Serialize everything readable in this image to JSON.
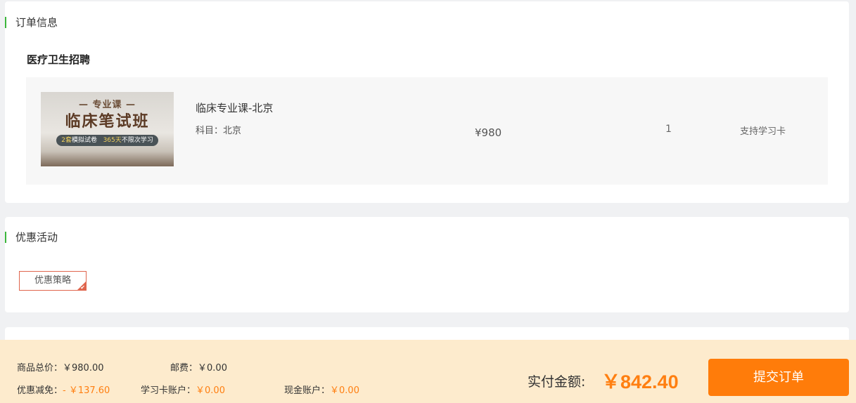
{
  "order_section": {
    "title": "订单信息",
    "category": "医疗卫生招聘",
    "item": {
      "thumbnail": {
        "subtitle": "— 专业课 —",
        "main": "临床笔试班",
        "pill_a_num": "2套",
        "pill_a_text": "模拟试卷",
        "pill_b_num": "365天",
        "pill_b_text": "不限次学习"
      },
      "name": "临床专业课-北京",
      "subject": "科目：北京",
      "price": "¥980",
      "quantity": "1",
      "support": "支持学习卡"
    }
  },
  "promo_section": {
    "title": "优惠活动",
    "tag_label": "优惠策略",
    "check_icon": "check-icon"
  },
  "footer": {
    "goods_total_label": "商品总价：",
    "goods_total_value": "￥980.00",
    "shipping_label": "邮费：",
    "shipping_value": "￥0.00",
    "discount_label": "优惠减免：",
    "discount_value": "- ￥137.60",
    "card_account_label": "学习卡账户：",
    "card_account_value": "￥0.00",
    "cash_account_label": "现金账户：",
    "cash_account_value": "￥0.00",
    "total_label": "实付金额:",
    "total_value": "￥842.40",
    "submit_label": "提交订单"
  },
  "colors": {
    "accent_green": "#3cb63c",
    "orange": "#ff7f11",
    "promo_border": "#e0654d",
    "footer_bg": "#fdebcd"
  }
}
